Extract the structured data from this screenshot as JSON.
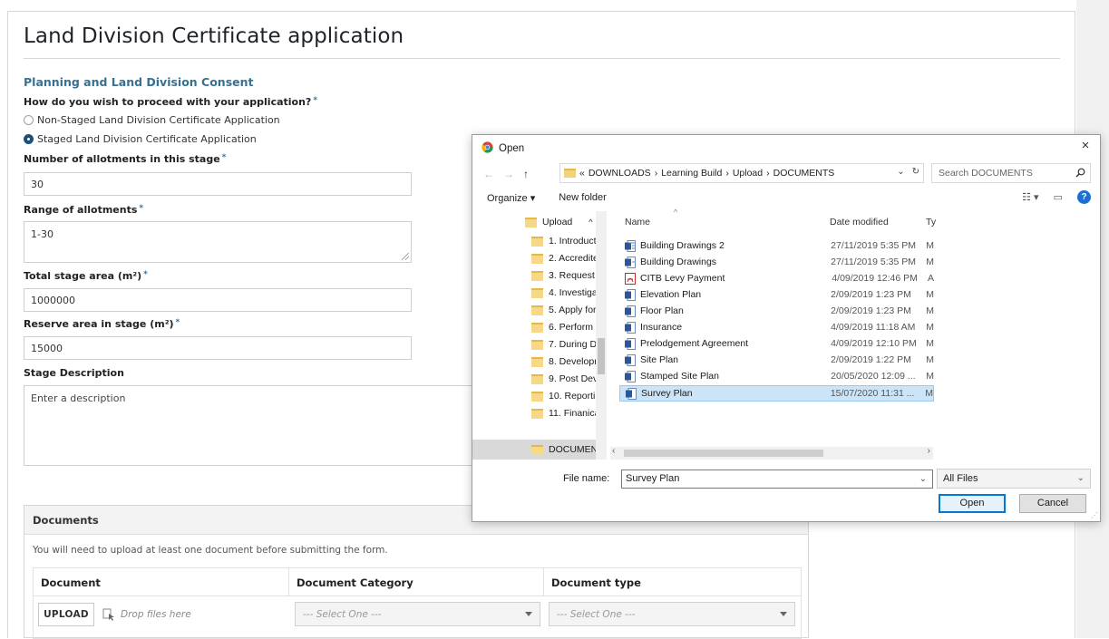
{
  "form": {
    "title": "Land Division Certificate application",
    "section": "Planning and Land Division Consent",
    "proceed_question": "How do you wish to proceed with your application?",
    "required_mark": "*",
    "options": [
      {
        "label": "Non-Staged Land Division Certificate Application",
        "checked": false
      },
      {
        "label": "Staged Land Division Certificate Application",
        "checked": true
      }
    ],
    "allotments_label": "Number of allotments in this stage",
    "allotments_value": "30",
    "range_label": "Range of allotments",
    "range_value": "1-30",
    "total_area_label": "Total stage area (m²)",
    "total_area_value": "1000000",
    "reserve_area_label": "Reserve area in stage (m²)",
    "reserve_area_value": "15000",
    "description_label": "Stage Description",
    "description_placeholder": "Enter a description"
  },
  "documents": {
    "heading": "Documents",
    "help": "You will need to upload at least one document before submitting the form.",
    "columns": [
      "Document",
      "Document Category",
      "Document type"
    ],
    "upload_label": "UPLOAD",
    "drop_label": "Drop files here",
    "category_placeholder": "--- Select One ---",
    "type_placeholder": "--- Select One ---"
  },
  "dialog": {
    "title": "Open",
    "close": "×",
    "path": [
      "«",
      "DOWNLOADS",
      "›",
      "Learning Build",
      "›",
      "Upload",
      "›",
      "DOCUMENTS"
    ],
    "search_placeholder": "Search DOCUMENTS",
    "organize": "Organize ▾",
    "new_folder": "New folder",
    "help_glyph": "?",
    "tree": [
      "Upload",
      "1. Introduct",
      "2. Accredite",
      "3. Request I",
      "4. Investiga",
      "5. Apply for",
      "6. Perform",
      "7. During D",
      "8. Developr",
      "9. Post Dev",
      "10. Reportir",
      "11. Finanica",
      "DOCUMEN"
    ],
    "columns": {
      "name": "Name",
      "date": "Date modified",
      "type": "Ty"
    },
    "files": [
      {
        "name": "Building Drawings 2",
        "date": "27/11/2019 5:35 PM",
        "type": "M",
        "kind": "word"
      },
      {
        "name": "Building Drawings",
        "date": "27/11/2019 5:35 PM",
        "type": "M",
        "kind": "word"
      },
      {
        "name": "CITB Levy Payment",
        "date": "4/09/2019 12:46 PM",
        "type": "A",
        "kind": "pdf"
      },
      {
        "name": "Elevation Plan",
        "date": "2/09/2019 1:23 PM",
        "type": "M",
        "kind": "word"
      },
      {
        "name": "Floor Plan",
        "date": "2/09/2019 1:23 PM",
        "type": "M",
        "kind": "word"
      },
      {
        "name": "Insurance",
        "date": "4/09/2019 11:18 AM",
        "type": "M",
        "kind": "word"
      },
      {
        "name": "Prelodgement Agreement",
        "date": "4/09/2019 12:10 PM",
        "type": "M",
        "kind": "word"
      },
      {
        "name": "Site Plan",
        "date": "2/09/2019 1:22 PM",
        "type": "M",
        "kind": "word"
      },
      {
        "name": "Stamped Site Plan",
        "date": "20/05/2020 12:09 ...",
        "type": "M",
        "kind": "word"
      },
      {
        "name": "Survey Plan",
        "date": "15/07/2020 11:31 ...",
        "type": "M",
        "kind": "word",
        "selected": true
      }
    ],
    "filename_label": "File name:",
    "filename_value": "Survey Plan",
    "filetype_value": "All Files",
    "open_label": "Open",
    "cancel_label": "Cancel"
  },
  "colors": {
    "accent": "#3a6f8f",
    "selection": "#cce4f7",
    "primary_border": "#0078d7"
  }
}
